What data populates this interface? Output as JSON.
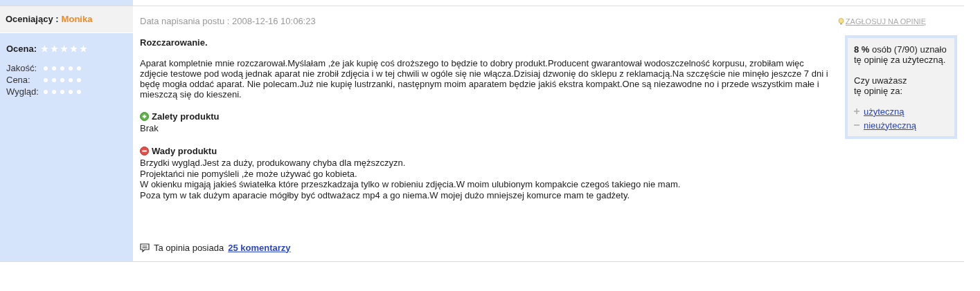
{
  "reviewer": {
    "label": "Oceniający :",
    "name": "Monika"
  },
  "ratings": {
    "overall": {
      "label": "Ocena:",
      "stars": 0
    },
    "items": [
      {
        "label": "Jakość:",
        "stars": 0
      },
      {
        "label": "Cena:",
        "stars": 0
      },
      {
        "label": "Wygląd:",
        "stars": 0
      }
    ]
  },
  "post_date": "Data napisania postu : 2008-12-16 10:06:23",
  "vote_link": "ZAGŁOSUJ NA OPINIĘ",
  "title": "Rozczarowanie.",
  "body": "Aparat kompletnie mnie rozczarował.Myślałam ,że jak kupię coś droższego to będzie to dobry produkt.Producent gwarantował wodoszczelność korpusu, zrobiłam więc zdjęcie testowe pod wodą jednak aparat nie zrobił zdjęcia i w tej chwili w ogóle się nie włącza.Dzisiaj dzwonię do sklepu z reklamacją.Na szczęście nie minęło jeszcze 7 dni i będę mogła oddać aparat. Nie polecam.Już nie kupię lustrzanki, następnym moim aparatem będzie jakiś ekstra kompakt.One są niezawodne no i przede wszystkim małe i mieszczą się do kieszeni.",
  "sections": [
    {
      "kind": "pros",
      "heading": "Zalety produktu",
      "lines": [
        "Brak"
      ]
    },
    {
      "kind": "cons",
      "heading": "Wady produktu",
      "lines": [
        "Brzydki wygląd.Jest za duży, produkowany chyba dla męższczyzn.",
        "Projektańci nie pomyśleli ,że może używać go kobieta.",
        "W okienku migają jakieś światełka które przeszkadzaja tylko w robieniu zdjęcia.W moim ulubionym kompakcie czegoś takiego nie mam.",
        "Poza tym w tak dużym aparacie mógłby być odtważacz mp4 a go niema.W mojej dużo mniejszej komurce mam te gadżety."
      ]
    }
  ],
  "comments": {
    "text": "Ta opinia posiada",
    "link": "25 komentarzy"
  },
  "helpfulness": {
    "percent": "8 %",
    "summary": "osób (7/90) uznało tę opinię za użyteczną.",
    "question": [
      "Czy uważasz",
      "tę opinię za:"
    ],
    "options": [
      {
        "kind": "plus",
        "label": "użyteczną"
      },
      {
        "kind": "minus",
        "label": "nieużyteczną"
      }
    ]
  }
}
